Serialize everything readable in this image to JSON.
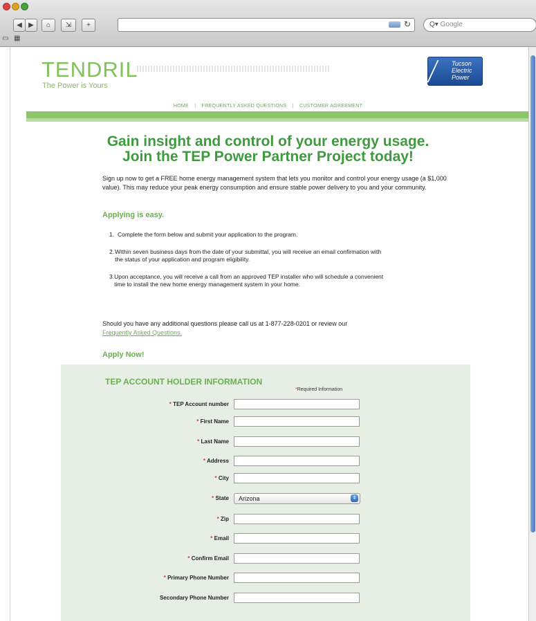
{
  "browser": {
    "search_placeholder": "Google",
    "nav_back_icon": "back-arrow",
    "nav_forward_icon": "forward-arrow",
    "home_icon": "home",
    "add_icon": "plus",
    "reload_icon": "reload"
  },
  "header": {
    "logo": "TENDRIL",
    "tagline": "The Power is Yours",
    "partner_logo": "Tucson Electric Power",
    "nav": [
      "HOME",
      "FREQUENTLY ASKED QUESTIONS",
      "CUSTOMER AGREEMENT"
    ],
    "nav_separator": "|"
  },
  "main": {
    "headline_line1": "Gain insight and control of your energy usage.",
    "headline_line2": "Join the TEP Power Partner Project today!",
    "intro": "Sign up now to get a FREE home energy management system that lets you monitor and control your energy usage (a $1,000 value). This may reduce your peak energy consumption and ensure stable power delivery to you and your community.",
    "applying_heading": "Applying is easy.",
    "steps": [
      {
        "num": "1.",
        "text": "Complete the form below and submit your application to the program."
      },
      {
        "num": "2.",
        "text": "Within seven business days from the date of your submittal, you will receive an email confirmation with the status of your application and program eligibility."
      },
      {
        "num": "3.",
        "text": "Upon acceptance, you will receive a call from an approved TEP installer who will schedule a convenient time to install the new home energy management system in your home."
      }
    ],
    "contact_text": "Should you have any additional questions please call us at 1-877-228-0201 or review our",
    "contact_link": "Frequently Asked Questions.",
    "apply_heading": "Apply Now!"
  },
  "form": {
    "title": "TEP ACCOUNT HOLDER INFORMATION",
    "required_note": "Required Information",
    "required_mark": "*",
    "fields": {
      "account_number": {
        "label": "TEP Account number",
        "value": ""
      },
      "first_name": {
        "label": "First Name",
        "value": ""
      },
      "last_name": {
        "label": "Last Name",
        "value": ""
      },
      "address": {
        "label": "Address",
        "value": ""
      },
      "city": {
        "label": "City",
        "value": ""
      },
      "state": {
        "label": "State",
        "value": "Arizona"
      },
      "zip": {
        "label": "Zip",
        "value": ""
      },
      "email": {
        "label": "Email",
        "value": ""
      },
      "confirm_email": {
        "label": "Confirm Email",
        "value": ""
      },
      "primary_phone": {
        "label": "Primary Phone Number",
        "value": ""
      },
      "secondary_phone": {
        "label": "Secondary Phone Number",
        "value": ""
      }
    }
  }
}
